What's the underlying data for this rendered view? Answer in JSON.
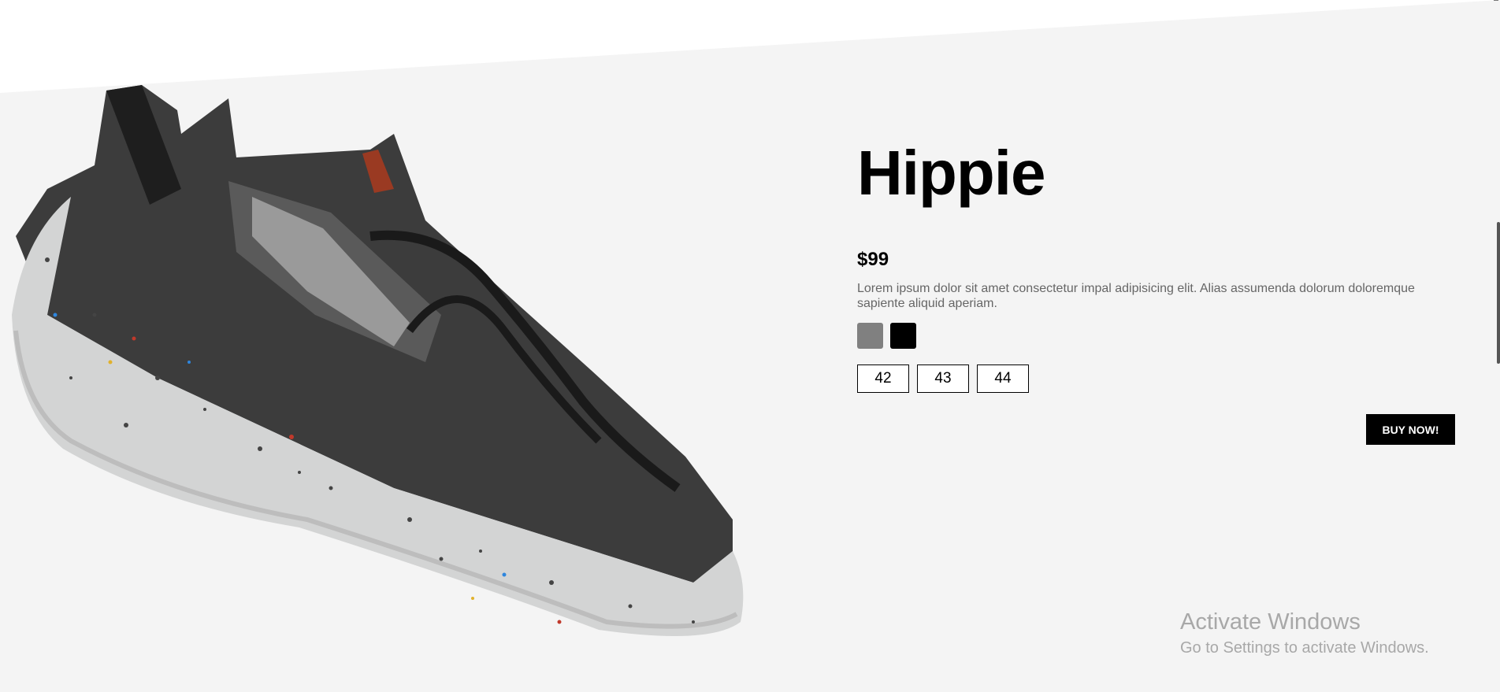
{
  "product": {
    "title": "Hippie",
    "price": "$99",
    "description": "Lorem ipsum dolor sit amet consectetur impal adipisicing elit. Alias assumenda dolorum doloremque sapiente aliquid aperiam.",
    "colors": [
      "#808080",
      "#000000"
    ],
    "sizes": [
      "42",
      "43",
      "44"
    ],
    "buy_label": "BUY NOW!"
  },
  "theme": {
    "background": "#f4f4f4",
    "accent": "#000000"
  },
  "watermark": {
    "title": "Activate Windows",
    "subtitle": "Go to Settings to activate Windows."
  }
}
